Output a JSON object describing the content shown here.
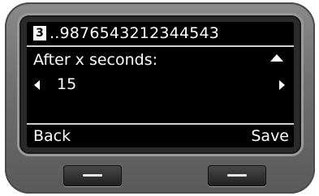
{
  "header": {
    "line_number": "3",
    "number_text": "..9876543212344543"
  },
  "setting": {
    "label": "After x seconds:",
    "value": "15"
  },
  "softkeys": {
    "left_label": "Back",
    "right_label": "Save"
  },
  "icons": {
    "scroll_up": "triangle-up-icon",
    "value_left": "triangle-left-icon",
    "value_right": "triangle-right-icon"
  },
  "colors": {
    "screen_bg": "#000000",
    "text": "#ffffff"
  }
}
